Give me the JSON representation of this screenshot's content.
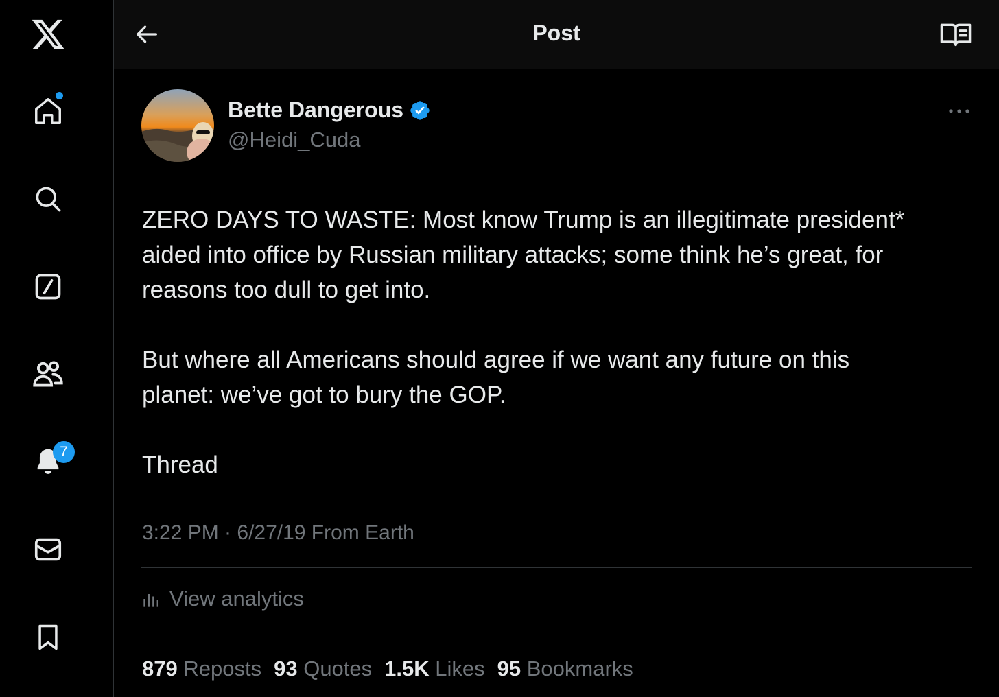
{
  "sidebar": {
    "logo_icon": "x-logo-icon",
    "items": [
      {
        "name": "home",
        "icon": "home-icon",
        "has_dot": true
      },
      {
        "name": "explore",
        "icon": "search-icon"
      },
      {
        "name": "grok",
        "icon": "grok-icon"
      },
      {
        "name": "communities",
        "icon": "people-icon"
      },
      {
        "name": "notifications",
        "icon": "bell-icon",
        "badge": "7"
      },
      {
        "name": "messages",
        "icon": "mail-icon"
      },
      {
        "name": "bookmarks",
        "icon": "bookmark-icon"
      }
    ],
    "notifications_badge": "7",
    "accent_color": "#1d9bf0"
  },
  "header": {
    "title": "Post",
    "back_icon": "arrow-left-icon",
    "reader_icon": "reader-mode-icon"
  },
  "post": {
    "author_name": "Bette Dangerous",
    "verified": true,
    "handle": "@Heidi_Cuda",
    "text": "ZERO DAYS TO WASTE: Most know Trump is an illegitimate president*\naided into office by Russian military attacks; some think he’s great, for\nreasons too dull to get into.\n\nBut where all Americans should agree if we want any future on this\nplanet: we’ve got to bury the GOP.\n\nThread",
    "timestamp": "3:22 PM · 6/27/19 From Earth",
    "analytics_label": "View analytics",
    "stats": {
      "reposts_count": "879",
      "reposts_label": "Reposts",
      "quotes_count": "93",
      "quotes_label": "Quotes",
      "likes_count": "1.5K",
      "likes_label": "Likes",
      "bookmarks_count": "95",
      "bookmarks_label": "Bookmarks"
    }
  }
}
